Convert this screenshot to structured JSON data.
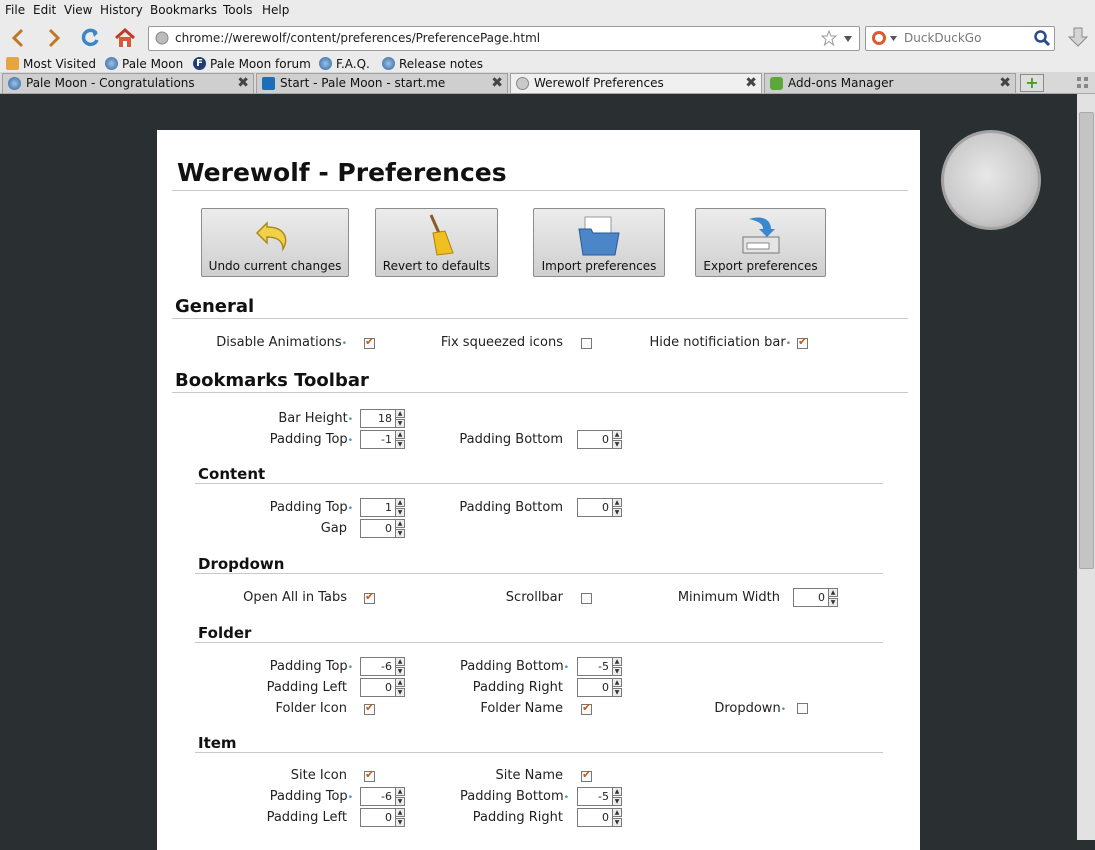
{
  "menubar": [
    "File",
    "Edit",
    "View",
    "History",
    "Bookmarks",
    "Tools",
    "Help"
  ],
  "nav": {
    "url": "chrome://werewolf/content/preferences/PreferencePage.html",
    "search_placeholder": "DuckDuckGo"
  },
  "bookmarks": [
    "Most Visited",
    "Pale Moon",
    "Pale Moon forum",
    "F.A.Q.",
    "Release notes"
  ],
  "tabs": [
    {
      "label": "Pale Moon - Congratulations"
    },
    {
      "label": "Start - Pale Moon - start.me"
    },
    {
      "label": "Werewolf Preferences"
    },
    {
      "label": "Add-ons Manager"
    }
  ],
  "page": {
    "title": "Werewolf - Preferences",
    "buttons": {
      "undo": "Undo current changes",
      "revert": "Revert to defaults",
      "import": "Import preferences",
      "export": "Export preferences"
    },
    "general": {
      "heading": "General",
      "disable_animations": "Disable Animations",
      "fix_squeezed": "Fix squeezed icons",
      "hide_notification": "Hide notificiation bar"
    },
    "bookmarks_toolbar": {
      "heading": "Bookmarks Toolbar",
      "bar_height": {
        "label": "Bar Height",
        "value": "18"
      },
      "padding_top": {
        "label": "Padding Top",
        "value": "-1"
      },
      "padding_bottom": {
        "label": "Padding Bottom",
        "value": "0"
      }
    },
    "content": {
      "heading": "Content",
      "padding_top": {
        "label": "Padding Top",
        "value": "1"
      },
      "padding_bottom": {
        "label": "Padding Bottom",
        "value": "0"
      },
      "gap": {
        "label": "Gap",
        "value": "0"
      }
    },
    "dropdown": {
      "heading": "Dropdown",
      "open_all": "Open All in Tabs",
      "scrollbar": "Scrollbar",
      "min_width": {
        "label": "Minimum Width",
        "value": "0"
      }
    },
    "folder": {
      "heading": "Folder",
      "padding_top": {
        "label": "Padding Top",
        "value": "-6"
      },
      "padding_bottom": {
        "label": "Padding Bottom",
        "value": "-5"
      },
      "padding_left": {
        "label": "Padding Left",
        "value": "0"
      },
      "padding_right": {
        "label": "Padding Right",
        "value": "0"
      },
      "folder_icon": "Folder Icon",
      "folder_name": "Folder Name",
      "dropdown": "Dropdown"
    },
    "item": {
      "heading": "Item",
      "site_icon": "Site Icon",
      "site_name": "Site Name",
      "padding_top": {
        "label": "Padding Top",
        "value": "-6"
      },
      "padding_bottom": {
        "label": "Padding Bottom",
        "value": "-5"
      },
      "padding_left": {
        "label": "Padding Left",
        "value": "0"
      },
      "padding_right": {
        "label": "Padding Right",
        "value": "0"
      }
    }
  }
}
